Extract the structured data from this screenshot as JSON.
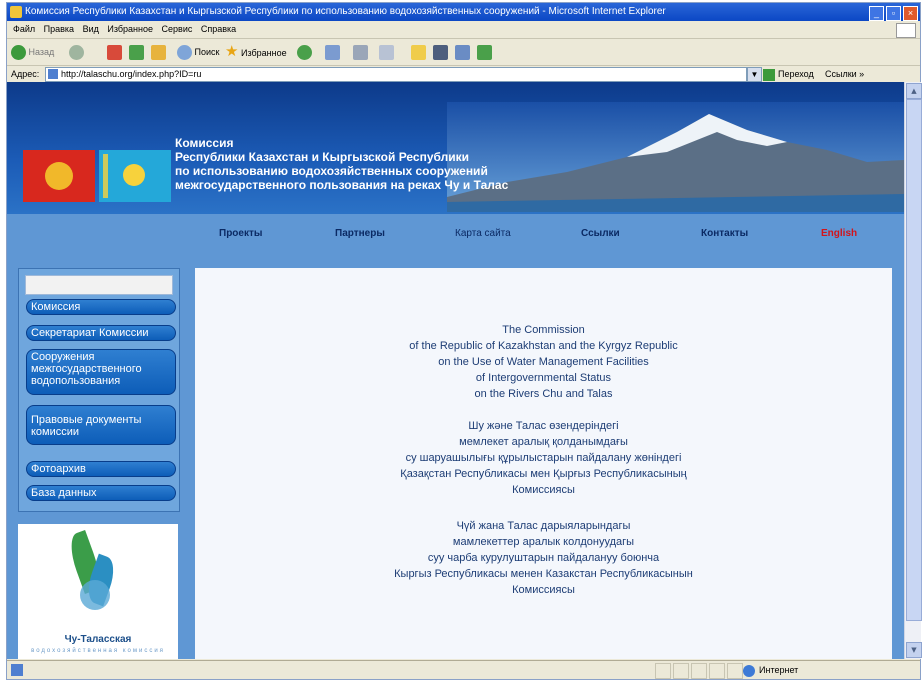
{
  "window": {
    "title": "Комиссия Республики Казахстан и Кыргызской Республики по использованию водохозяйственных сооружений - Microsoft Internet Explorer"
  },
  "menu": [
    "Файл",
    "Правка",
    "Вид",
    "Избранное",
    "Сервис",
    "Справка"
  ],
  "toolbar": {
    "back": "Назад",
    "search": "Поиск",
    "favorites": "Избранное"
  },
  "address": {
    "label": "Адрес:",
    "url": "http://talaschu.org/index.php?ID=ru",
    "go": "Переход",
    "links": "Ссылки »"
  },
  "banner": {
    "line1": "Комиссия",
    "line2": "Республики Казахстан и Кыргызской Республики",
    "line3": "по использованию водохозяйственных сооружений",
    "line4": "межгосударственного пользования на реках Чу и Талас"
  },
  "nav": {
    "projects": "Проекты",
    "partners": "Партнеры",
    "sitemap": "Карта сайта",
    "links": "Ссылки",
    "contacts": "Контакты",
    "english": "English"
  },
  "sidebar": {
    "items": [
      {
        "label": "Комиссия"
      },
      {
        "label": "Секретариат Комиссии"
      },
      {
        "label": "Сооружения межгосударственного водопользования"
      },
      {
        "label": "Правовые документы комиссии"
      },
      {
        "label": "Фотоархив"
      },
      {
        "label": "База данных"
      }
    ]
  },
  "logo": {
    "name": "Чу-Таласская",
    "sub": "водохозяйственная комиссия"
  },
  "content": {
    "en": [
      "The Commission",
      "of the Republic of Kazakhstan and the Kyrgyz Republic",
      "on the Use of Water Management Facilities",
      "of Intergovernmental Status",
      "on the Rivers Chu and Talas"
    ],
    "kz": [
      "Шу және Талас өзендеріндегі",
      "мемлекет аралық қолданымдағы",
      "су шаруашылығы құрылыстарын пайдалану жөніндегі",
      "Қазақстан Республикасы мен Қырғыз Республикасының",
      "Комиссиясы"
    ],
    "ky": [
      "Чүй жана Талас дарыяларындагы",
      "мамлекеттер аралык колдонуудагы",
      "суу чарба курулуштарын пайдалануу боюнча",
      "Кыргыз Республикасы менен Казакстан Республикасынын",
      "Комиссиясы"
    ]
  },
  "status": {
    "zone": "Интернет"
  }
}
